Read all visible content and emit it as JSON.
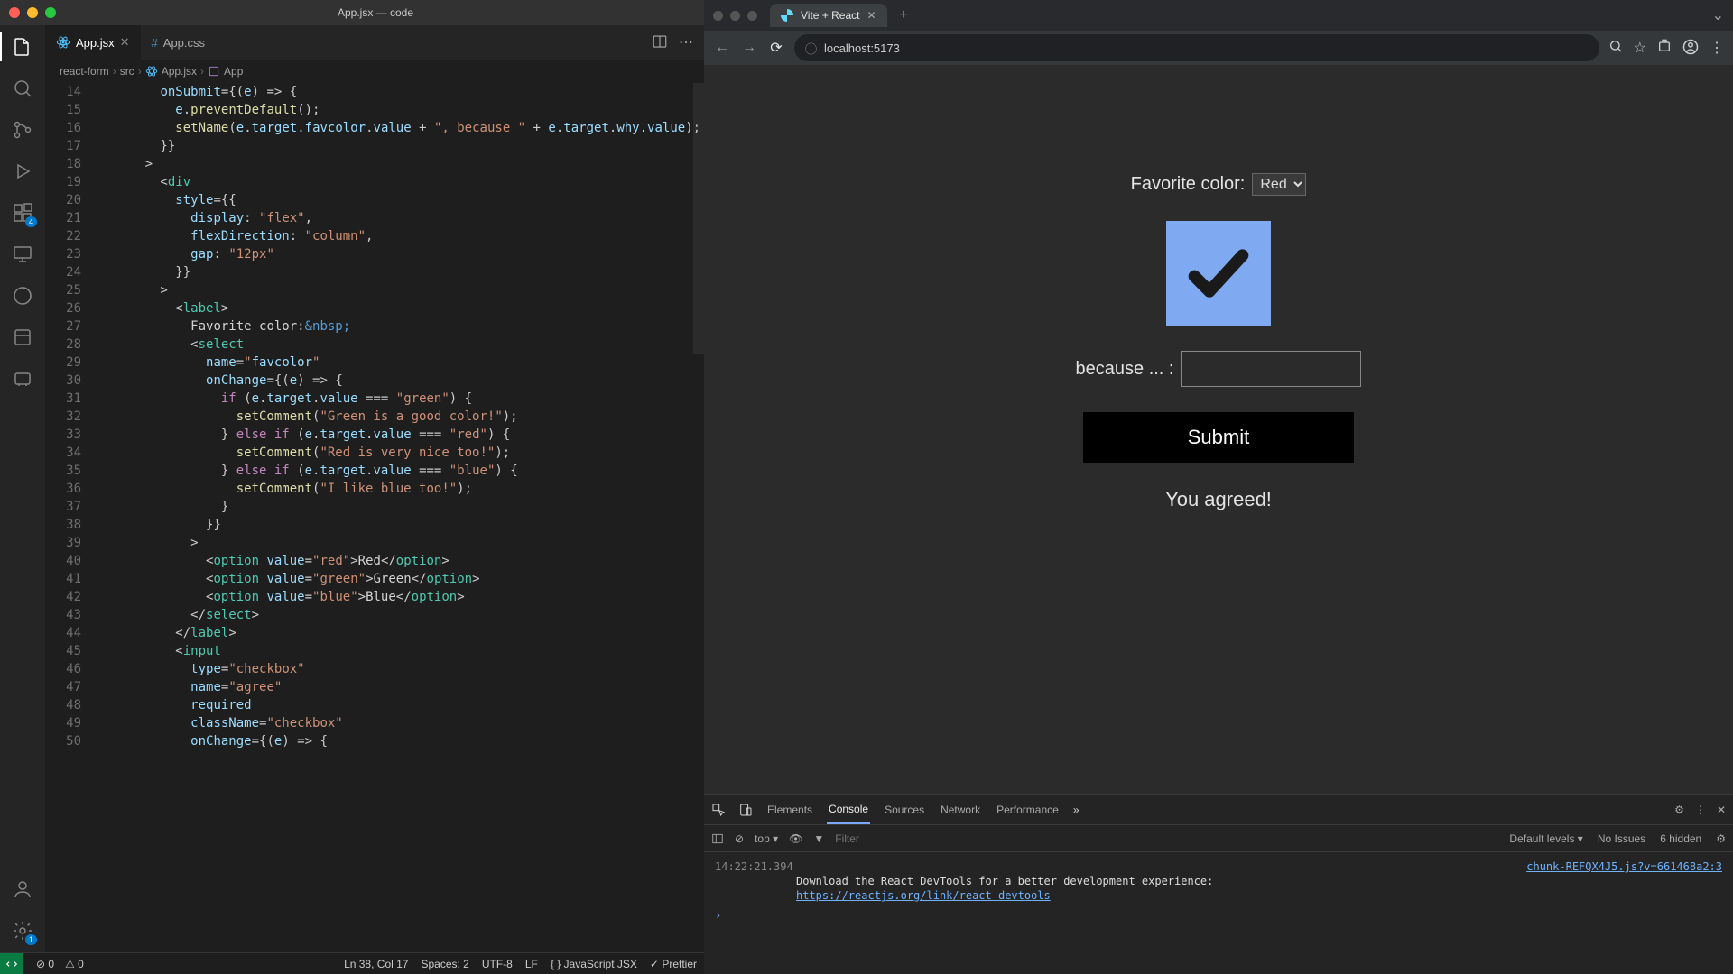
{
  "vscode": {
    "title": "App.jsx — code",
    "tabs": [
      {
        "label": "App.jsx",
        "icon": "react-icon",
        "active": true
      },
      {
        "label": "App.css",
        "icon": "hash-icon",
        "active": false
      }
    ],
    "breadcrumbs": {
      "project": "react-form",
      "folder": "src",
      "file": "App.jsx",
      "symbol": "App"
    },
    "activity_badges": {
      "extensions": "4",
      "settings": "1"
    },
    "cursor_hint_line": 38,
    "line_start": 14,
    "line_end": 50,
    "code_lines": [
      "        onSubmit={(e) => {",
      "          e.preventDefault();",
      "          setName(e.target.favcolor.value + \", because \" + e.target.why.value);",
      "        }}",
      "      >",
      "        <div",
      "          style={{",
      "            display: \"flex\",",
      "            flexDirection: \"column\",",
      "            gap: \"12px\"",
      "          }}",
      "        >",
      "          <label>",
      "            Favorite color:&nbsp;",
      "            <select",
      "              name=\"favcolor\"",
      "              onChange={(e) => {",
      "                if (e.target.value === \"green\") {",
      "                  setComment(\"Green is a good color!\");",
      "                } else if (e.target.value === \"red\") {",
      "                  setComment(\"Red is very nice too!\");",
      "                } else if (e.target.value === \"blue\") {",
      "                  setComment(\"I like blue too!\");",
      "                }",
      "              }}",
      "            >",
      "              <option value=\"red\">Red</option>",
      "              <option value=\"green\">Green</option>",
      "              <option value=\"blue\">Blue</option>",
      "            </select>",
      "          </label>",
      "          <input",
      "            type=\"checkbox\"",
      "            name=\"agree\"",
      "            required",
      "            className=\"checkbox\"",
      "            onChange={(e) => {"
    ],
    "statusbar": {
      "errors": "0",
      "warnings": "0",
      "position": "Ln 38, Col 17",
      "spaces": "Spaces: 2",
      "encoding": "UTF-8",
      "eol": "LF",
      "language": "JavaScript JSX",
      "formatter": "Prettier"
    }
  },
  "browser": {
    "tab_title": "Vite + React",
    "url": "localhost:5173",
    "page": {
      "favorite_label": "Favorite color:",
      "select_value": "Red",
      "because_label": "because ... :",
      "because_value": "",
      "submit_label": "Submit",
      "agreed_text": "You agreed!"
    },
    "devtools": {
      "tabs": [
        "Elements",
        "Console",
        "Sources",
        "Network",
        "Performance"
      ],
      "active_tab": "Console",
      "context": "top",
      "filter_placeholder": "Filter",
      "levels": "Default levels",
      "issues": "No Issues",
      "hidden": "6 hidden",
      "log": {
        "timestamp": "14:22:21.394",
        "source": "chunk-REFQX4J5.js?v=661468a2:3",
        "message": "Download the React DevTools for a better development experience:",
        "link": "https://reactjs.org/link/react-devtools"
      }
    }
  }
}
